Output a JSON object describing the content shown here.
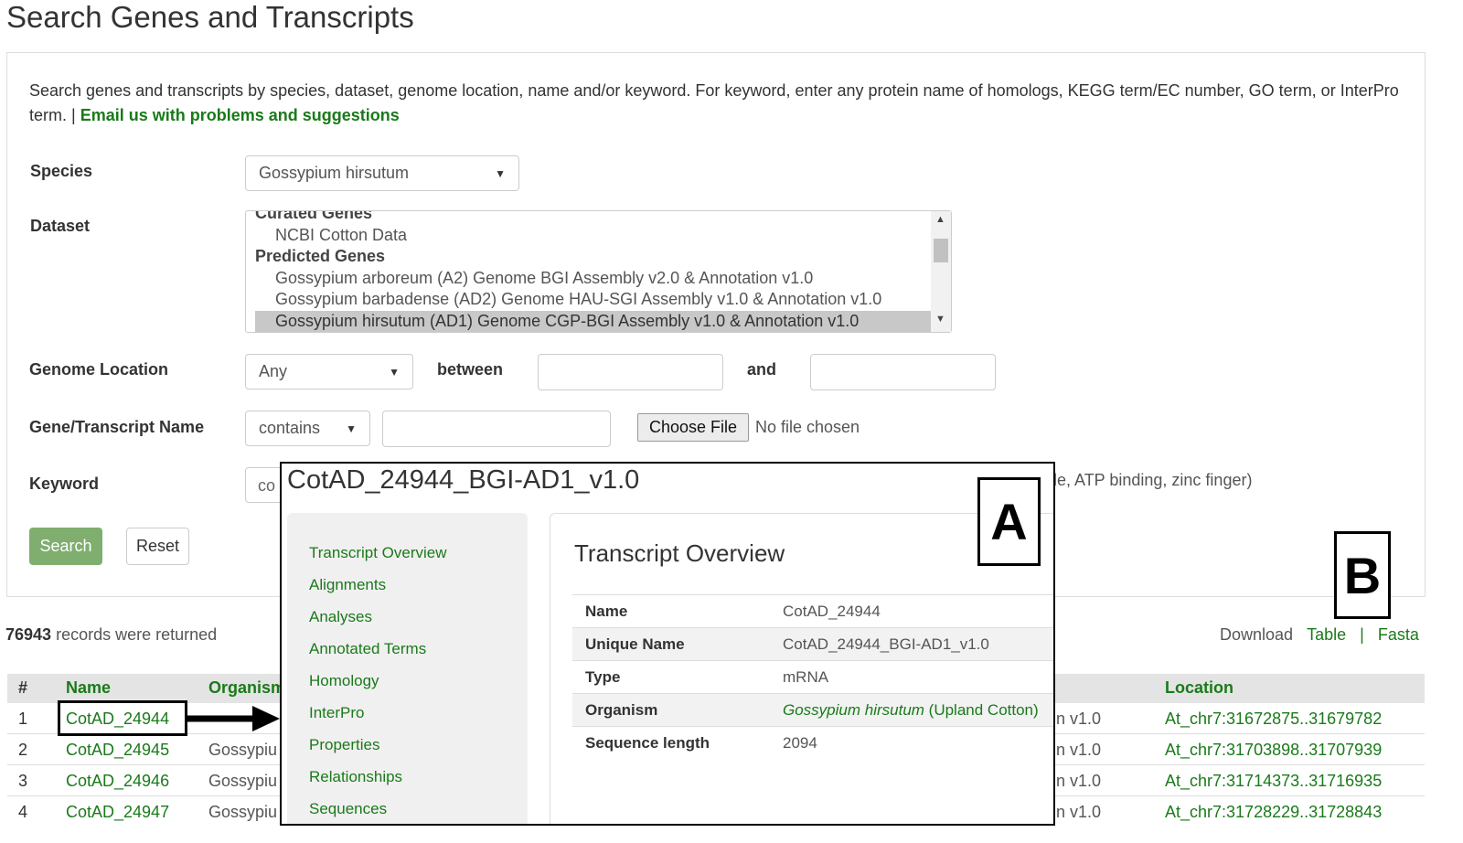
{
  "page": {
    "title": "Search Genes and Transcripts",
    "intro_text": "Search genes and transcripts by species, dataset, genome location, name and/or keyword. For keyword, enter any protein name of homologs, KEGG term/EC number, GO term, or InterPro term. | ",
    "intro_link": "Email us with problems and suggestions"
  },
  "form": {
    "species_label": "Species",
    "species_value": "Gossypium hirsutum",
    "dataset_label": "Dataset",
    "dataset_options": {
      "group1_partial": "Curated Genes",
      "opt1": "NCBI Cotton Data",
      "group2": "Predicted Genes",
      "opt2": "Gossypium arboreum (A2) Genome BGI Assembly v2.0 & Annotation v1.0",
      "opt3": "Gossypium barbadense (AD2) Genome HAU-SGI Assembly v1.0 & Annotation v1.0",
      "opt4_selected": "Gossypium hirsutum (AD1) Genome CGP-BGI Assembly v1.0 & Annotation v1.0"
    },
    "location_label": "Genome Location",
    "location_value": "Any",
    "between_label": "between",
    "and_label": "and",
    "name_label": "Gene/Transcript Name",
    "name_mode": "contains",
    "choose_file": "Choose File",
    "no_file": "No file chosen",
    "keyword_label": "Keyword",
    "keyword_partial": "co",
    "keyword_hint_partial": "le, ATP binding, zinc finger)",
    "search_button": "Search",
    "reset_button": "Reset"
  },
  "results": {
    "count": "76943",
    "count_text": "records were returned",
    "download_label": "Download",
    "table_link": "Table",
    "separator": "|",
    "fasta_link": "Fasta",
    "headers": {
      "num": "#",
      "name": "Name",
      "organism_partial": "Organism",
      "location": "Location"
    },
    "rows": [
      {
        "num": "1",
        "name": "CotAD_24944",
        "organism": "",
        "analysis_tail": "n v1.0",
        "location": "At_chr7:31672875..31679782"
      },
      {
        "num": "2",
        "name": "CotAD_24945",
        "organism": "Gossypiu",
        "analysis_tail": "n v1.0",
        "location": "At_chr7:31703898..31707939"
      },
      {
        "num": "3",
        "name": "CotAD_24946",
        "organism": "Gossypiu",
        "analysis_tail": "n v1.0",
        "location": "At_chr7:31714373..31716935"
      },
      {
        "num": "4",
        "name": "CotAD_24947",
        "organism": "Gossypiu",
        "analysis_tail": "n v1.0",
        "location": "At_chr7:31728229..31728843"
      }
    ]
  },
  "overlay": {
    "title": "CotAD_24944_BGI-AD1_v1.0",
    "nav": [
      "Transcript Overview",
      "Alignments",
      "Analyses",
      "Annotated Terms",
      "Homology",
      "InterPro",
      "Properties",
      "Relationships",
      "Sequences"
    ],
    "card_title": "Transcript Overview",
    "fields": [
      {
        "key": "Name",
        "value": "CotAD_24944"
      },
      {
        "key": "Unique Name",
        "value": "CotAD_24944_BGI-AD1_v1.0"
      },
      {
        "key": "Type",
        "value": "mRNA"
      },
      {
        "key": "Organism",
        "value_italic": "Gossypium hirsutum",
        "value_rest": " (Upland Cotton)"
      },
      {
        "key": "Sequence length",
        "value": "2094"
      }
    ]
  },
  "callouts": {
    "a": "A",
    "b": "B"
  }
}
